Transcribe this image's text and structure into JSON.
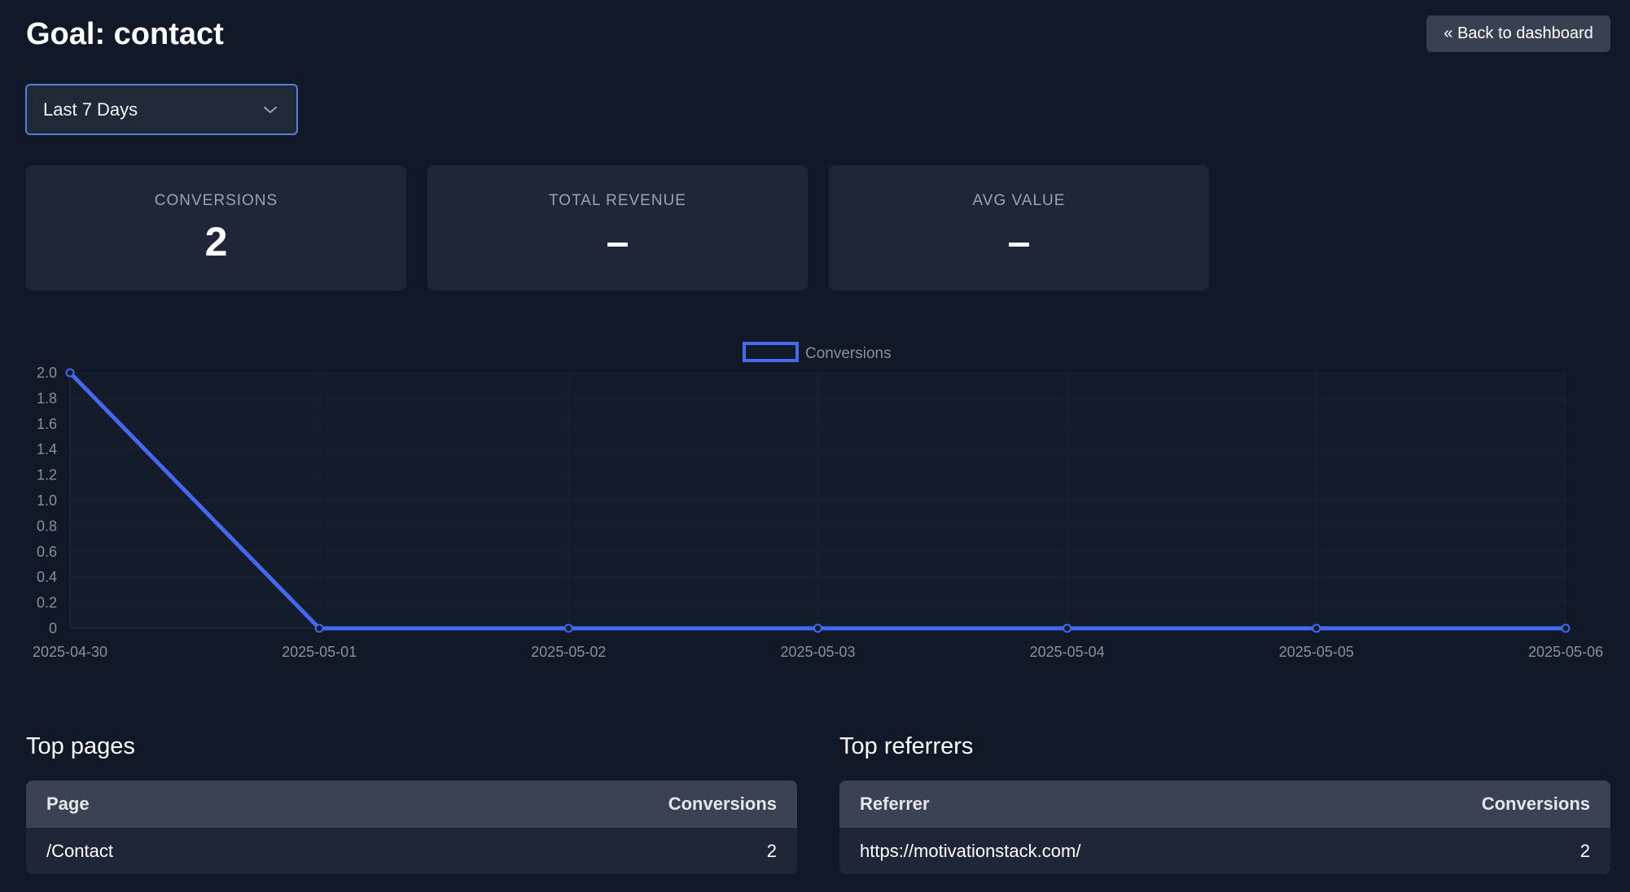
{
  "header": {
    "title": "Goal: contact",
    "back_label": "« Back to dashboard"
  },
  "range_select": {
    "selected": "Last 7 Days"
  },
  "stats": [
    {
      "label": "CONVERSIONS",
      "value": "2"
    },
    {
      "label": "TOTAL REVENUE",
      "value": "–"
    },
    {
      "label": "AVG VALUE",
      "value": "–"
    }
  ],
  "chart_data": {
    "type": "line",
    "x": [
      "2025-04-30",
      "2025-05-01",
      "2025-05-02",
      "2025-05-03",
      "2025-05-04",
      "2025-05-05",
      "2025-05-06"
    ],
    "series": [
      {
        "name": "Conversions",
        "values": [
          2,
          0,
          0,
          0,
          0,
          0,
          0
        ],
        "color": "#4468f0"
      }
    ],
    "y_ticks": [
      "0",
      "0.2",
      "0.4",
      "0.6",
      "0.8",
      "1.0",
      "1.2",
      "1.4",
      "1.6",
      "1.8",
      "2.0"
    ],
    "ylim": [
      0,
      2
    ],
    "legend_position": "top-center",
    "grid": true
  },
  "top_pages": {
    "title": "Top pages",
    "columns": [
      "Page",
      "Conversions"
    ],
    "rows": [
      [
        "/Contact",
        "2"
      ]
    ]
  },
  "top_referrers": {
    "title": "Top referrers",
    "columns": [
      "Referrer",
      "Conversions"
    ],
    "rows": [
      [
        "https://motivationstack.com/",
        "2"
      ]
    ]
  },
  "colors": {
    "background": "#111827",
    "card": "#1f2637",
    "accent": "#4468f0",
    "table_header": "#3b4254"
  }
}
